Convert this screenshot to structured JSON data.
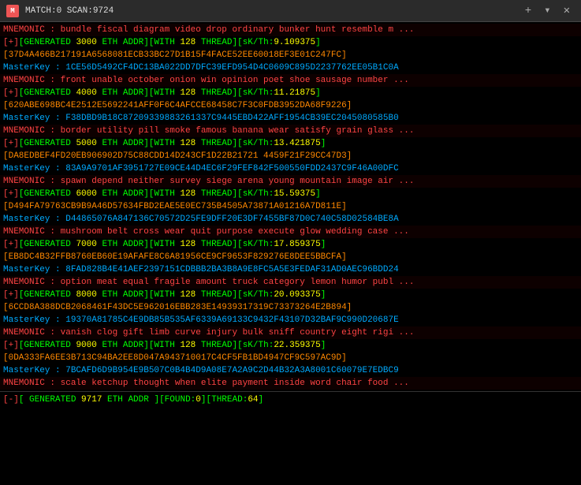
{
  "titlebar": {
    "icon": "M",
    "title": "MATCH:0 SCAN:9724",
    "plus_label": "+",
    "arrow_label": "▾",
    "close_label": "✕"
  },
  "lines": [
    {
      "type": "mnemonic",
      "text": "MNEMONIC : bundle fiscal diagram video drop ordinary bunker hunt resemble m ..."
    },
    {
      "type": "generated",
      "text": "[+][GENERATED 3000 ETH ADDR][WITH 128 THREAD][sK/Th:9.109375]"
    },
    {
      "type": "addr",
      "text": "[37D4A466B217191A6568081ECB33BC27D1B15F4FACE52EE60018EF3E01C247FC]"
    },
    {
      "type": "masterkey",
      "text": "MasterKey : 1CE56D5492CF4DC13BA022DD7DFC39EFD954D4C0609C895D2237762EE05B1C0A"
    },
    {
      "type": "mnemonic",
      "text": "MNEMONIC : front unable october onion win opinion poet shoe sausage number ..."
    },
    {
      "type": "generated",
      "text": "[+][GENERATED 4000 ETH ADDR][WITH 128 THREAD][sK/Th:11.21875]"
    },
    {
      "type": "addr",
      "text": "[620ABE698BC4E2512E5692241AFF0F6C4AFCCE68458C7F3C0FDB3952DA68F9226]"
    },
    {
      "type": "masterkey",
      "text": "MasterKey : F38DBD9B18C87209339883261337C9445EBD422AFF1954CB39EC2045080585B0"
    },
    {
      "type": "mnemonic",
      "text": "MNEMONIC : border utility pill smoke famous banana wear satisfy grain glass ..."
    },
    {
      "type": "generated",
      "text": "[+][GENERATED 5000 ETH ADDR][WITH 128 THREAD][sK/Th:13.421875]"
    },
    {
      "type": "addr",
      "text": "[DA8EDBEF4FD20EB906902D75C88CDD14D243CF1D22B21721 4459F21F29CC47D3]"
    },
    {
      "type": "masterkey",
      "text": "MasterKey : 83A9A9701AF3951727E09CE44D4EC6F29FEF842F500550FDD2437C9F46A00DFC"
    },
    {
      "type": "mnemonic",
      "text": "MNEMONIC : spawn depend neither survey siege arena young mountain image air ..."
    },
    {
      "type": "generated",
      "text": "[+][GENERATED 6000 ETH ADDR][WITH 128 THREAD][sK/Th:15.59375]"
    },
    {
      "type": "addr",
      "text": "[D494FA79763CB9B9A46D57634FBD2EAE5E0EC735B4505A73871A01216A7D811E]"
    },
    {
      "type": "masterkey",
      "text": "MasterKey : D44865076A847136C70572D25FE9DFF20E3DF7455BF87D0C740C58D02584BE8A"
    },
    {
      "type": "mnemonic",
      "text": "MNEMONIC : mushroom belt cross wear quit purpose execute glow wedding case ..."
    },
    {
      "type": "generated",
      "text": "[+][GENERATED 7000 ETH ADDR][WITH 128 THREAD][sK/Th:17.859375]"
    },
    {
      "type": "addr",
      "text": "[EB8DC4B32FFB8760EB60E19AFAFE8C6A81956CE9CF9653F829276E8DEE5BBCFA]"
    },
    {
      "type": "masterkey",
      "text": "MasterKey : 8FAD828B4E41AEF2397151CDBBB2BA3B8A9E8FC5A5E3FEDAF31AD0AEC96BDD24"
    },
    {
      "type": "mnemonic",
      "text": "MNEMONIC : option meat equal fragile amount truck category lemon humor publ ..."
    },
    {
      "type": "generated",
      "text": "[+][GENERATED 8000 ETH ADDR][WITH 128 THREAD][sK/Th:20.093375]"
    },
    {
      "type": "addr",
      "text": "[6CCD8A388DCB2068461F43DC5E962016EBB283E14939317319C73373264E2B894]"
    },
    {
      "type": "masterkey",
      "text": "MasterKey : 19370A81785C4E9DB85B535AF6339A69133C9432F43107D32BAF9C990D20687E"
    },
    {
      "type": "mnemonic",
      "text": "MNEMONIC : vanish clog gift limb curve injury bulk sniff country eight rigi ..."
    },
    {
      "type": "generated",
      "text": "[+][GENERATED 9000 ETH ADDR][WITH 128 THREAD][sK/Th:22.359375]"
    },
    {
      "type": "addr",
      "text": "[0DA333FA6EE3B713C94BA2EE8D047A943710017C4CF5FB1BD4947CF9C597AC9D]"
    },
    {
      "type": "masterkey",
      "text": "MasterKey : 7BCAFD6D9B954E9B507C0B4B4D9A08E7A2A9C2D44B32A3A8001C60079E7EDBC9"
    },
    {
      "type": "mnemonic",
      "text": "MNEMONIC : scale ketchup thought when elite payment inside word chair food ..."
    },
    {
      "type": "status",
      "text": "[-][ GENERATED 9717 ETH ADDR ][FOUND:0][THREAD:64]"
    }
  ]
}
